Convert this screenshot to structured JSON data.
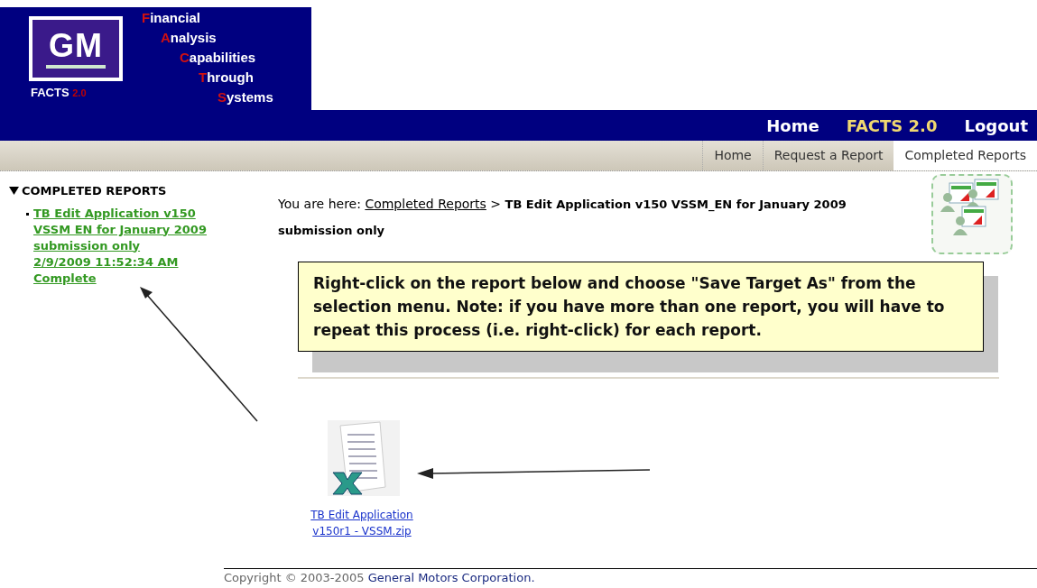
{
  "logo": {
    "mark": "GM",
    "product": "FACTS",
    "version": "2.0"
  },
  "acronym": [
    "Financial",
    "Analysis",
    "Capabilities",
    "Through",
    "Systems"
  ],
  "nav": [
    {
      "label": "Home",
      "selected": false
    },
    {
      "label": "FACTS 2.0",
      "selected": true
    },
    {
      "label": "Logout",
      "selected": false
    }
  ],
  "tabs": [
    {
      "label": "Home",
      "selected": false
    },
    {
      "label": "Request a Report",
      "selected": false
    },
    {
      "label": "Completed Reports",
      "selected": true
    }
  ],
  "sidebar": {
    "heading": "COMPLETED REPORTS",
    "expanded": true,
    "items": [
      {
        "lines": [
          "TB Edit Application v150",
          "VSSM  EN for January 2009",
          "submission only",
          "2/9/2009 11:52:34 AM",
          "Complete"
        ]
      }
    ]
  },
  "breadcrumb": {
    "prefix": "You are here:",
    "link": "Completed Reports",
    "separator": ">",
    "current": "TB Edit Application v150 VSSM_EN for January 2009 submission only"
  },
  "notice": "Right-click on the report below and choose \"Save Target As\" from the selection menu. Note: if you have more than one report, you will have to repeat this process (i.e. right-click) for each report.",
  "file": {
    "lines": [
      "TB Edit Application",
      "v150r1 - VSSM.zip"
    ]
  },
  "footer": {
    "text": "Copyright © 2003-2005",
    "company": "General Motors Corporation."
  }
}
